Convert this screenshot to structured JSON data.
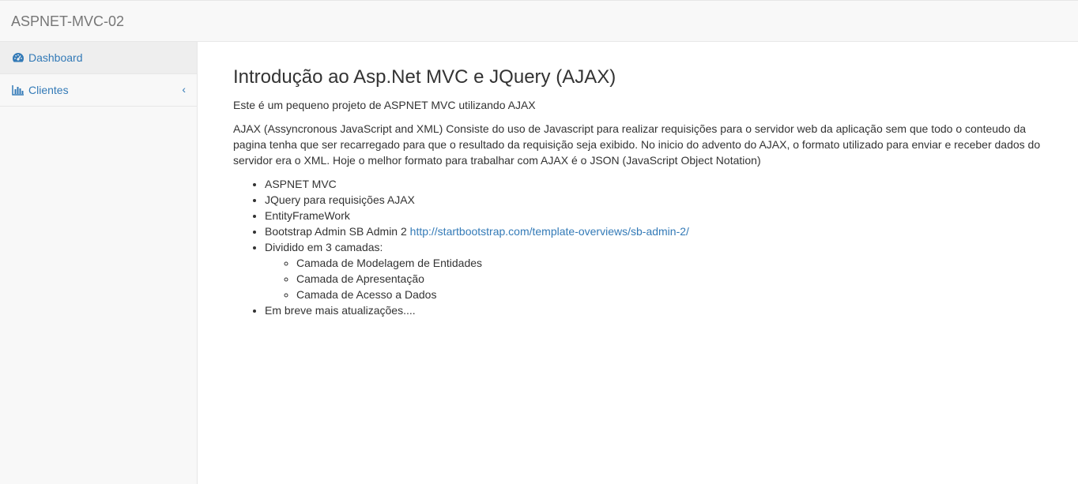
{
  "navbar": {
    "brand": "ASPNET-MVC-02"
  },
  "sidebar": {
    "items": [
      {
        "label": "Dashboard",
        "icon": "dashboard-icon"
      },
      {
        "label": "Clientes",
        "icon": "bar-chart-icon",
        "arrow": "‹"
      }
    ]
  },
  "main": {
    "title": "Introdução ao Asp.Net MVC e JQuery (AJAX)",
    "intro": "Este é um pequeno projeto de ASPNET MVC utilizando AJAX",
    "description": "AJAX (Assyncronous JavaScript and XML) Consiste do uso de Javascript para realizar requisições para o servidor web da aplicação sem que todo o conteudo da pagina tenha que ser recarregado para que o resultado da requisição seja exibido. No inicio do advento do AJAX, o formato utilizado para enviar e receber dados do servidor era o XML. Hoje o melhor formato para trabalhar com AJAX é o JSON (JavaScript Object Notation)",
    "list": {
      "item1": "ASPNET MVC",
      "item2": "JQuery para requisições AJAX",
      "item3": "EntityFrameWork",
      "item4_text": "Bootstrap Admin SB Admin 2 ",
      "item4_link": "http://startbootstrap.com/template-overviews/sb-admin-2/",
      "item5": "Dividido em 3 camadas:",
      "sub": [
        "Camada de Modelagem de Entidades",
        "Camada de Apresentação",
        "Camada de Acesso a Dados"
      ],
      "item6": "Em breve mais atualizações...."
    }
  },
  "colors": {
    "link": "#337ab7",
    "text": "#333333",
    "brand": "#777777"
  }
}
